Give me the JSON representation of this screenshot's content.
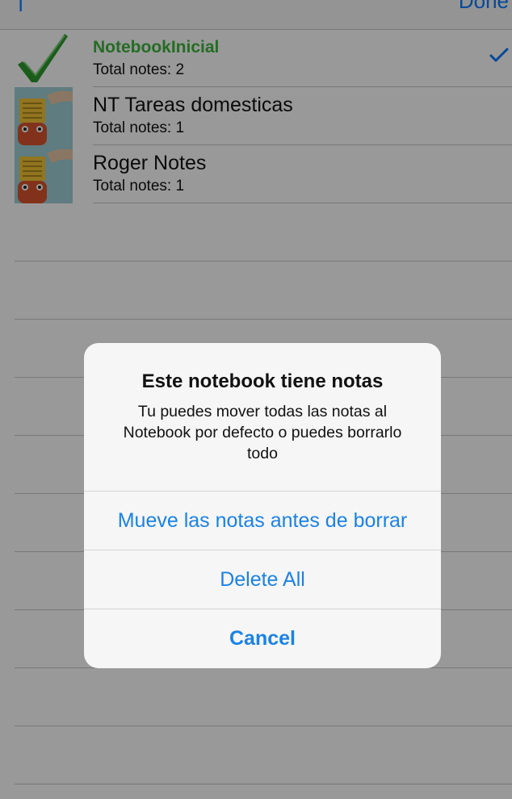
{
  "navbar": {
    "done_label": "Done",
    "left_glyph": "|"
  },
  "notebooks": [
    {
      "title": "NotebookInicial",
      "subtitle": "Total notes: 2",
      "icon": "green-check-icon",
      "selected": true
    },
    {
      "title": "NT Tareas domesticas",
      "subtitle": "Total notes: 1",
      "icon": "notebook-thumb-icon",
      "selected": false
    },
    {
      "title": "Roger Notes",
      "subtitle": "Total notes: 1",
      "icon": "notebook-thumb-icon",
      "selected": false
    }
  ],
  "alert": {
    "title": "Este notebook tiene notas",
    "message": "Tu puedes mover todas las notas al Notebook por defecto o puedes borrarlo todo",
    "buttons": {
      "move": "Mueve las notas antes de borrar",
      "delete_all": "Delete All",
      "cancel": "Cancel"
    }
  },
  "colors": {
    "accent": "#1a82e6",
    "selected_title": "#3cb43c",
    "dim_overlay": "rgba(0,0,0,0.40)"
  }
}
